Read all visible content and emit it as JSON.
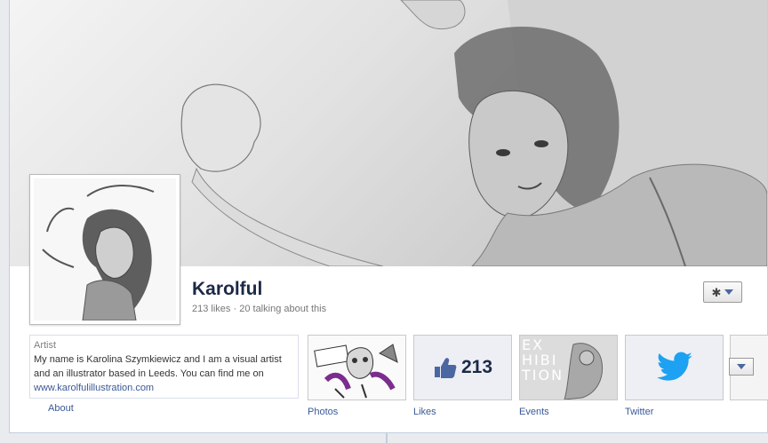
{
  "page": {
    "name": "Karolful",
    "likes_count": "213 likes",
    "talking": "20 talking about this",
    "stats_separator": "·"
  },
  "about": {
    "category": "Artist",
    "description": "My name is Karolina Szymkiewicz and I am a visual artist and an illustrator based in Leeds. You can find me on ",
    "website": "www.karolfulillustration.com",
    "link_label": "About"
  },
  "apps": [
    {
      "label": "Photos"
    },
    {
      "label": "Likes",
      "count": "213"
    },
    {
      "label": "Events",
      "exhibition_text": "EX HIBI TION"
    },
    {
      "label": "Twitter"
    }
  ],
  "colors": {
    "link": "#3b5998",
    "name": "#1c2a47",
    "twitter": "#1da1f2",
    "like_thumb": "#4b67a1"
  },
  "icons": {
    "gear": "gear-icon",
    "caret": "chevron-down-icon",
    "like": "thumbs-up-icon",
    "twitter": "twitter-bird-icon"
  }
}
